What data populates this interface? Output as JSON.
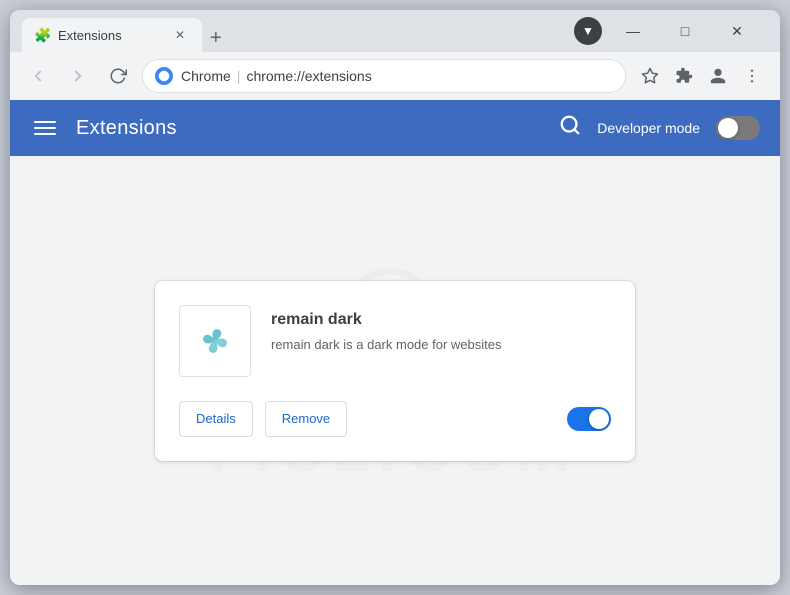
{
  "browser": {
    "tab_title": "Extensions",
    "tab_favicon": "puzzle",
    "address_domain": "Chrome",
    "address_path": "chrome://extensions",
    "new_tab_label": "+",
    "win_minimize": "—",
    "win_maximize": "□",
    "win_close": "✕"
  },
  "toolbar": {
    "back_title": "Back",
    "forward_title": "Forward",
    "reload_title": "Reload",
    "star_title": "Bookmark",
    "extensions_title": "Extensions",
    "profile_title": "Profile",
    "menu_title": "Menu"
  },
  "page_header": {
    "title": "Extensions",
    "search_label": "Search",
    "dev_mode_label": "Developer mode",
    "dev_mode_on": false
  },
  "extension": {
    "name": "remain dark",
    "description": "remain dark is a dark mode for websites",
    "details_btn": "Details",
    "remove_btn": "Remove",
    "enabled": true
  },
  "watermark": {
    "text": "FISL.COM"
  }
}
